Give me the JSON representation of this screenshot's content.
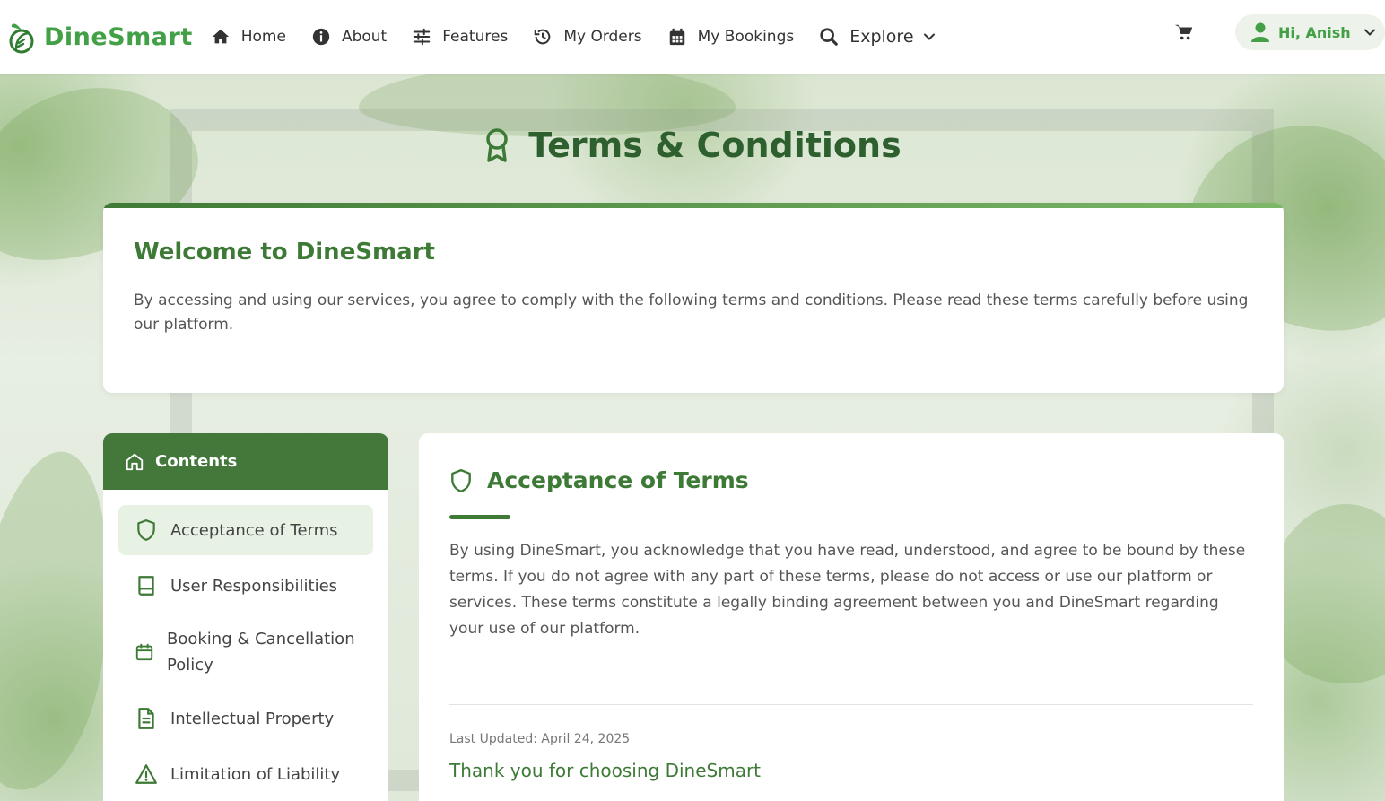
{
  "brand": {
    "name": "DineSmart"
  },
  "nav": {
    "items": [
      {
        "label": "Home",
        "icon": "home-icon"
      },
      {
        "label": "About",
        "icon": "info-icon"
      },
      {
        "label": "Features",
        "icon": "sliders-icon"
      },
      {
        "label": "My Orders",
        "icon": "history-icon"
      },
      {
        "label": "My Bookings",
        "icon": "calendar-icon"
      },
      {
        "label": "Explore",
        "icon": "search-icon"
      }
    ],
    "cart_icon": "cart-icon",
    "user_greeting": "Hi, Anish"
  },
  "page": {
    "title": "Terms & Conditions"
  },
  "welcome": {
    "heading": "Welcome to DineSmart",
    "text": "By accessing and using our services, you agree to comply with the following terms and conditions. Please read these terms carefully before using our platform."
  },
  "sidebar": {
    "title": "Contents",
    "items": [
      {
        "label": "Acceptance of Terms",
        "icon": "shield-icon",
        "active": true
      },
      {
        "label": "User Responsibilities",
        "icon": "book-icon",
        "active": false
      },
      {
        "label": "Booking & Cancellation Policy",
        "icon": "calendar-icon",
        "active": false
      },
      {
        "label": "Intellectual Property",
        "icon": "document-icon",
        "active": false
      },
      {
        "label": "Limitation of Liability",
        "icon": "warning-icon",
        "active": false
      }
    ]
  },
  "content": {
    "section_title": "Acceptance of Terms",
    "body": "By using DineSmart, you acknowledge that you have read, understood, and agree to be bound by these terms. If you do not agree with any part of these terms, please do not access or use our platform or services. These terms constitute a legally binding agreement between you and DineSmart regarding your use of our platform.",
    "last_updated": "Last Updated: April 24, 2025",
    "thanks": "Thank you for choosing DineSmart"
  },
  "colors": {
    "brand_green": "#43a047",
    "dark_green": "#2e5f2e",
    "header_green": "#43783a",
    "active_bg": "#e8f2e4"
  }
}
